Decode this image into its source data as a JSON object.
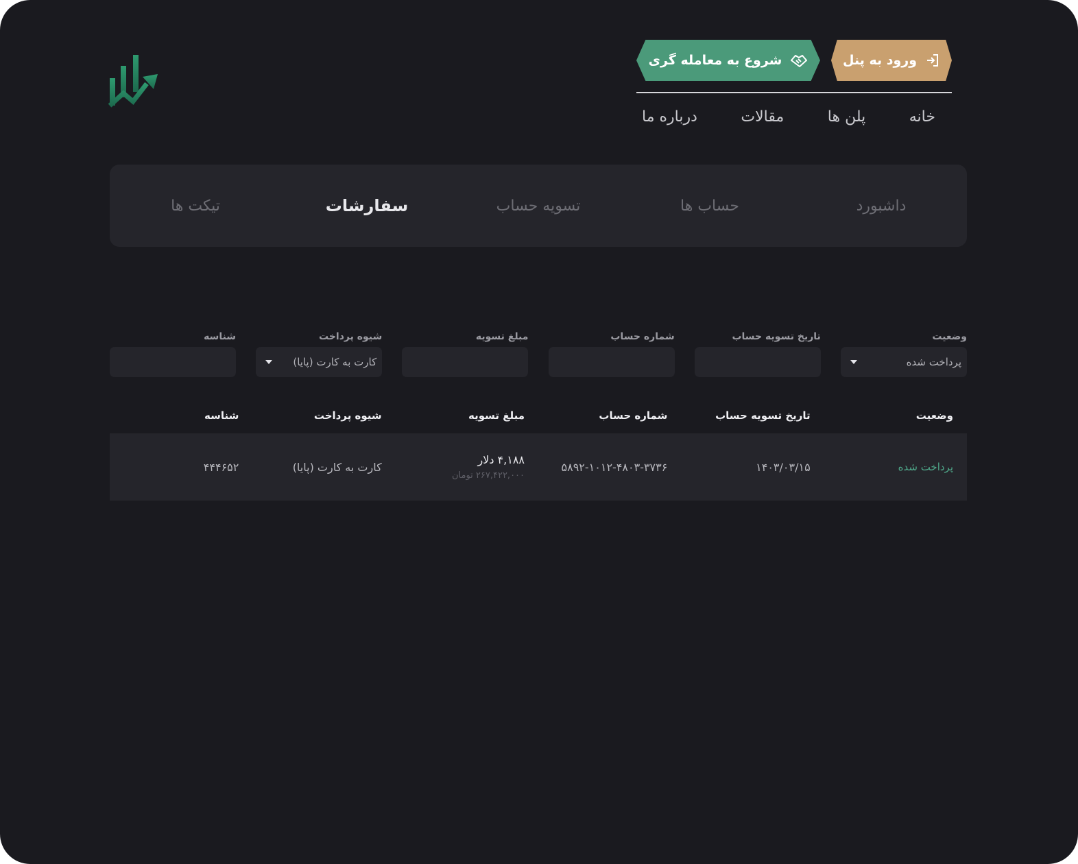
{
  "header": {
    "login_button": "ورود به پنل",
    "trade_button": "شروع به معامله گری",
    "nav": [
      "خانه",
      "پلن ها",
      "مقالات",
      "درباره ما"
    ]
  },
  "colors": {
    "background": "#1a1a1f",
    "panel": "#25252b",
    "accent_green": "#4b9a7a",
    "accent_gold": "#c9a06f",
    "status_paid": "#4fa88a"
  },
  "icons": {
    "logo": "chart-arrow-logo",
    "login": "sign-in-icon",
    "trade": "handshake-icon",
    "select": "caret-down-icon"
  },
  "tabs": {
    "items": [
      "داشبورد",
      "حساب ها",
      "تسویه حساب",
      "سفارشات",
      "تیکت ها"
    ],
    "active": "سفارشات"
  },
  "filters": {
    "status_label": "وضعیت",
    "status_value": "پرداخت شده",
    "settle_date_label": "تاریخ تسویه حساب",
    "account_label": "شماره حساب",
    "amount_label": "مبلغ تسویه",
    "payment_label": "شیوه پرداخت",
    "payment_value": "کارت به کارت (پایا)",
    "id_label": "شناسه"
  },
  "table": {
    "columns": [
      "وضعیت",
      "تاریخ تسویه حساب",
      "شماره حساب",
      "مبلغ تسویه",
      "شیوه پرداخت",
      "شناسه"
    ],
    "rows": [
      {
        "status": "پرداخت شده",
        "date": "۱۴۰۳/۰۳/۱۵",
        "account": "۵۸۹۲-۱۰۱۲-۴۸۰۳-۳۷۳۶",
        "amount_usd": "۴,۱۸۸ دلار",
        "amount_toman": "۲۶۷,۴۲۲,۰۰۰ تومان",
        "payment": "کارت به کارت (پایا)",
        "id": "۴۴۴۶۵۲"
      }
    ]
  }
}
